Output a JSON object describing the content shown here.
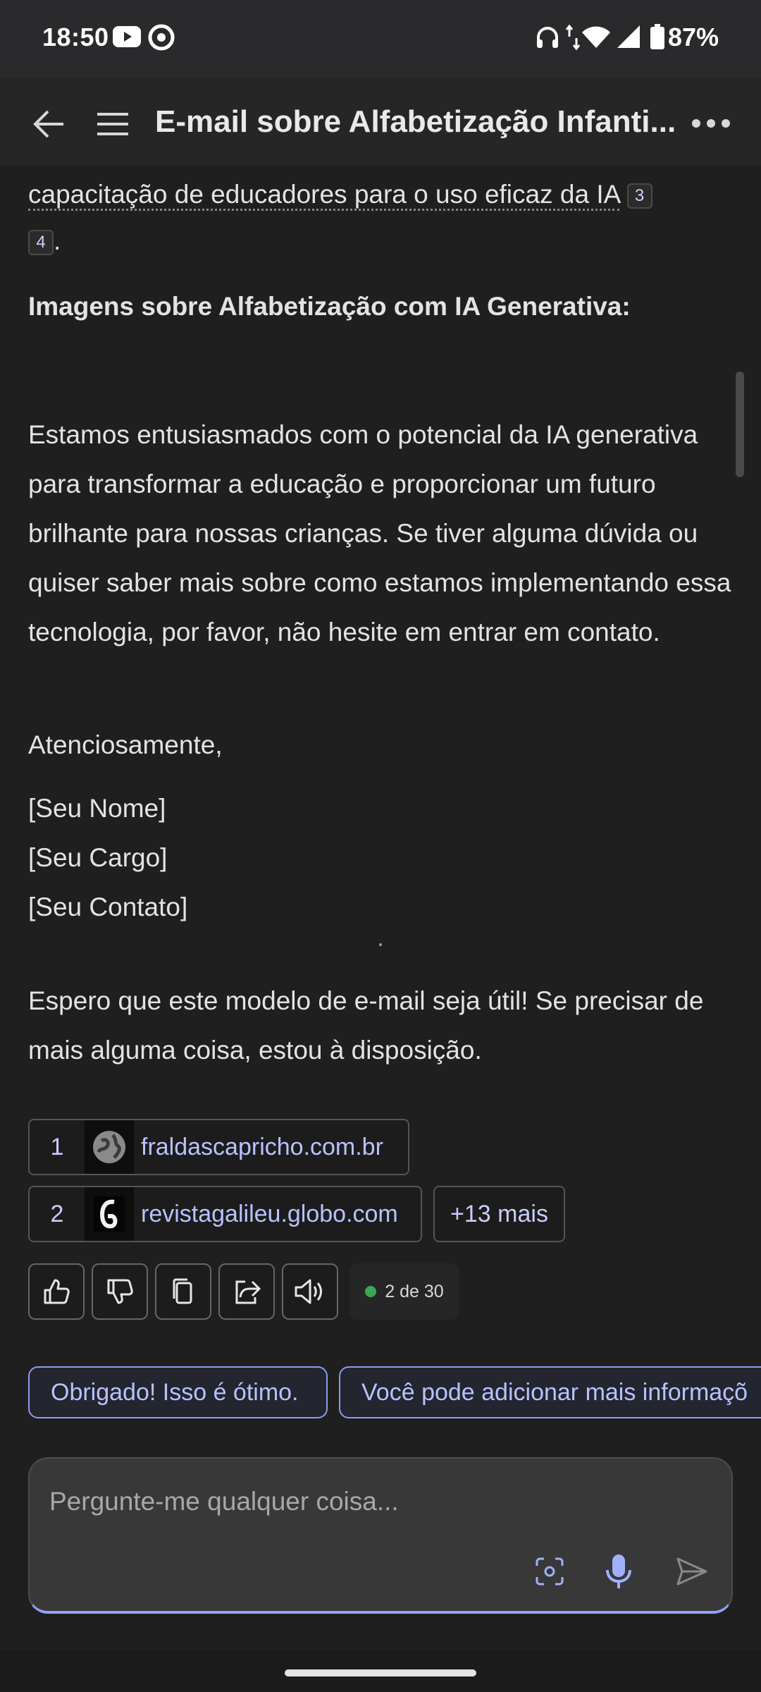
{
  "status_bar": {
    "time": "18:50",
    "battery": "87%",
    "icons": [
      "youtube-icon",
      "chrome-icon",
      "headphones-icon",
      "data-arrows-icon",
      "wifi-icon",
      "signal-icon",
      "battery-icon"
    ]
  },
  "app_bar": {
    "title": "E-mail sobre Alfabetização Infanti..."
  },
  "message": {
    "line1": "capacitação de educadores para o uso eficaz da IA",
    "cite_a": "3",
    "cite_b": "4",
    "heading": "Imagens sobre Alfabetização com IA Generativa:",
    "paragraph": "Estamos entusiasmados com o potencial da IA generativa para transformar a educação e proporcionar um futuro brilhante para nossas crianças. Se tiver alguma dúvida ou quiser saber mais sobre como estamos implementando essa tecnologia, por favor, não hesite em entrar em contato.",
    "closing": "Atenciosamente,",
    "sig_name": "[Seu Nome]",
    "sig_role": "[Seu Cargo]",
    "sig_contact": "[Seu Contato]",
    "followup": "Espero que este modelo de e-mail seja útil! Se precisar de mais alguma coisa, estou à disposição."
  },
  "sources": [
    {
      "num": "1",
      "domain": "fraldascapricho.com.br",
      "icon": "globe-icon"
    },
    {
      "num": "2",
      "domain": "revistagalileu.globo.com",
      "icon": "galileu-logo-icon"
    }
  ],
  "more_sources": "+13 mais",
  "response_count": "2 de 30",
  "suggestions": [
    "Obrigado! Isso é ótimo.",
    "Você pode adicionar mais informaçõ"
  ],
  "input": {
    "placeholder": "Pergunte-me qualquer coisa..."
  }
}
